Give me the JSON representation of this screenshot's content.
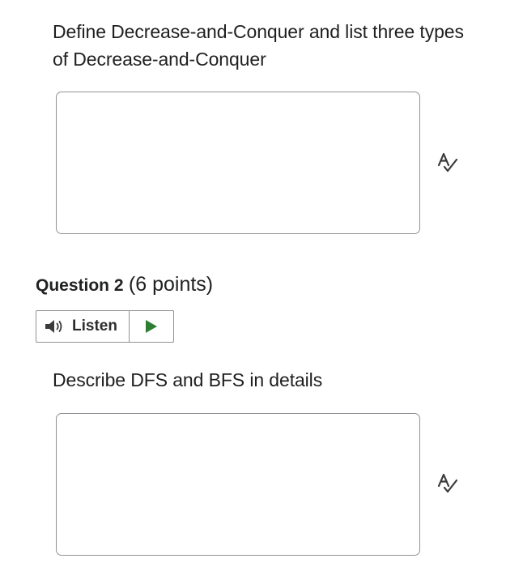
{
  "question1": {
    "prompt": "Define Decrease-and-Conquer and  list three types of Decrease-and-Conquer",
    "answer_value": ""
  },
  "question2": {
    "heading_label": "Question 2",
    "points_label": "(6 points)",
    "listen_label": "Listen",
    "prompt": "Describe DFS and BFS in details",
    "answer_value": ""
  },
  "icons": {
    "spell_check": "spell-check-icon",
    "speaker": "speaker-icon",
    "play": "play-icon"
  },
  "colors": {
    "play_green": "#2e7d32",
    "border": "#8f9296",
    "text": "#202122"
  }
}
